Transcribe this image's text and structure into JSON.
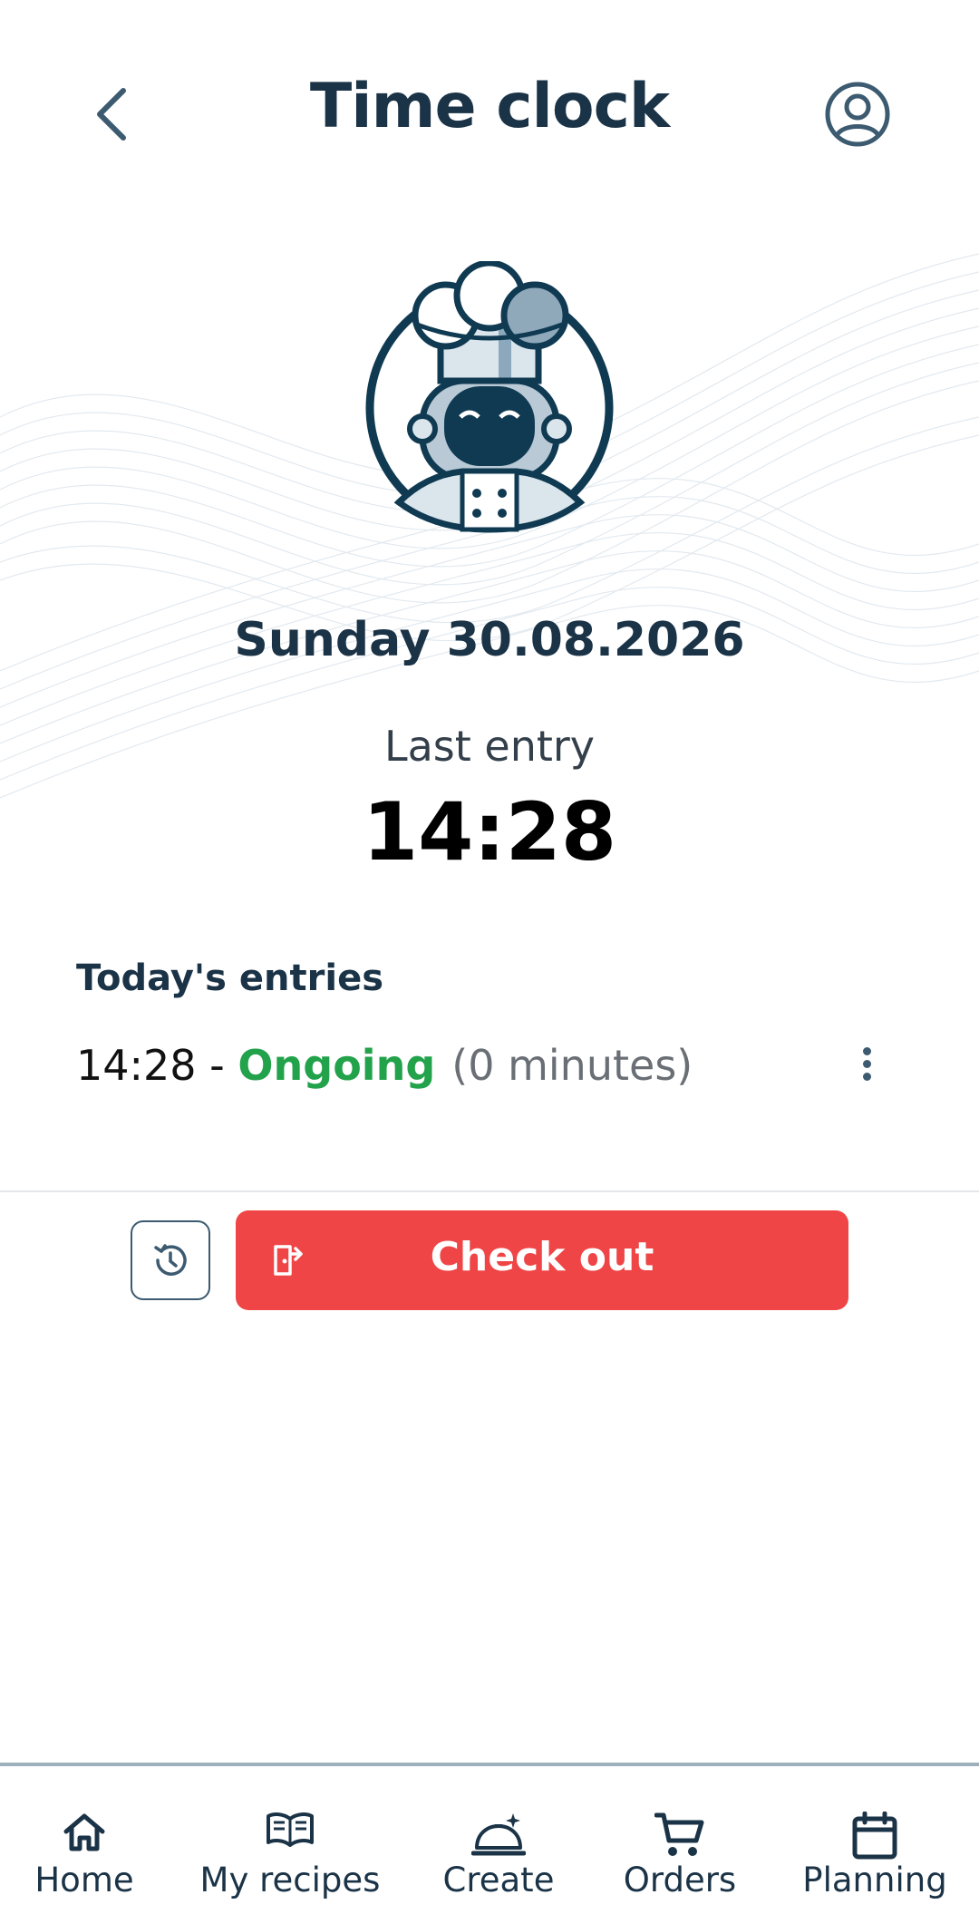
{
  "header": {
    "title": "Time clock",
    "back_icon": "chevron-left-icon",
    "profile_icon": "user-circle-icon"
  },
  "avatar": {
    "icon": "chef-robot-avatar"
  },
  "date_label": "Sunday 30.08.2026",
  "last_entry": {
    "label": "Last entry",
    "time": "14:28"
  },
  "todays_entries": {
    "heading": "Today's entries",
    "items": [
      {
        "time": "14:28 - ",
        "status": "Ongoing",
        "duration": "(0 minutes)"
      }
    ]
  },
  "actions": {
    "history_icon": "history-icon",
    "checkout_label": "Check out",
    "checkout_icon": "exit-door-icon",
    "checkout_color": "#ef4546"
  },
  "bottom_nav": {
    "items": [
      {
        "label": "Home",
        "icon": "home-icon"
      },
      {
        "label": "My recipes",
        "icon": "book-icon"
      },
      {
        "label": "Create",
        "icon": "cloche-icon"
      },
      {
        "label": "Orders",
        "icon": "cart-icon"
      },
      {
        "label": "Planning",
        "icon": "calendar-icon"
      }
    ]
  },
  "colors": {
    "primary": "#1b3347",
    "success": "#22a24a",
    "danger": "#ef4546"
  }
}
